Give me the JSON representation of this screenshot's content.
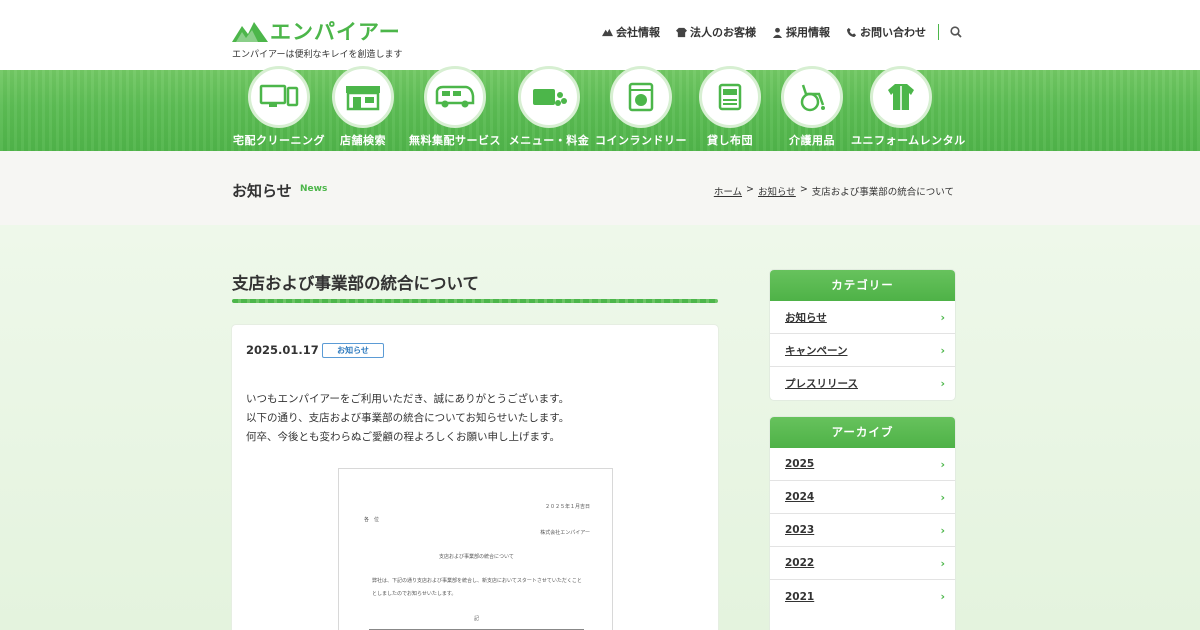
{
  "header": {
    "logo_text": "エンパイアー",
    "tagline": "エンパイアーは便利なキレイを創造します",
    "nav": [
      {
        "label": "会社情報",
        "icon": "mountain-icon"
      },
      {
        "label": "法人のお客様",
        "icon": "shirt-icon"
      },
      {
        "label": "採用情報",
        "icon": "person-icon"
      },
      {
        "label": "お問い合わせ",
        "icon": "phone-icon"
      }
    ],
    "search_icon": "search-icon"
  },
  "services": [
    {
      "label": "宅配クリーニング",
      "icon": "devices-icon"
    },
    {
      "label": "店舗検索",
      "icon": "store-icon"
    },
    {
      "label": "無料集配サービス",
      "icon": "van-icon"
    },
    {
      "label": "メニュー・料金",
      "icon": "wallet-icon"
    },
    {
      "label": "コインランドリー",
      "icon": "washer-icon"
    },
    {
      "label": "貸し布団",
      "icon": "futon-icon"
    },
    {
      "label": "介護用品",
      "icon": "wheelchair-icon"
    },
    {
      "label": "ユニフォームレンタル",
      "icon": "uniform-icon"
    }
  ],
  "page": {
    "title": "お知らせ",
    "title_en": "News",
    "breadcrumb": [
      "ホーム",
      "お知らせ",
      "支店および事業部の統合について"
    ]
  },
  "article": {
    "title": "支店および事業部の統合について",
    "date": "2025.01.17",
    "tag": "お知らせ",
    "body": [
      "いつもエンパイアーをご利用いただき、誠にありがとうございます。",
      "以下の通り、支店および事業部の統合についてお知らせいたします。",
      "何卒、今後とも変わらぬご愛顧の程よろしくお願い申し上げます。"
    ],
    "document": {
      "date": "２０２５年１月吉日",
      "to": "各　位",
      "from": "株式会社エンパイアー",
      "heading": "支店および事業部の統合について",
      "line1": "弊社は、下記の通り支店および事業部を統合し、新支店においてスタートさせていただくこと",
      "line2": "としましたのでお知らせいたします。",
      "ki": "記"
    }
  },
  "sidebar": {
    "category_title": "カテゴリー",
    "categories": [
      "お知らせ",
      "キャンペーン",
      "プレスリリース"
    ],
    "archive_title": "アーカイブ",
    "archives": [
      "2025",
      "2024",
      "2023",
      "2022",
      "2021"
    ]
  },
  "colors": {
    "brand_green": "#4cb64a",
    "tag_blue": "#2f7bbf"
  }
}
